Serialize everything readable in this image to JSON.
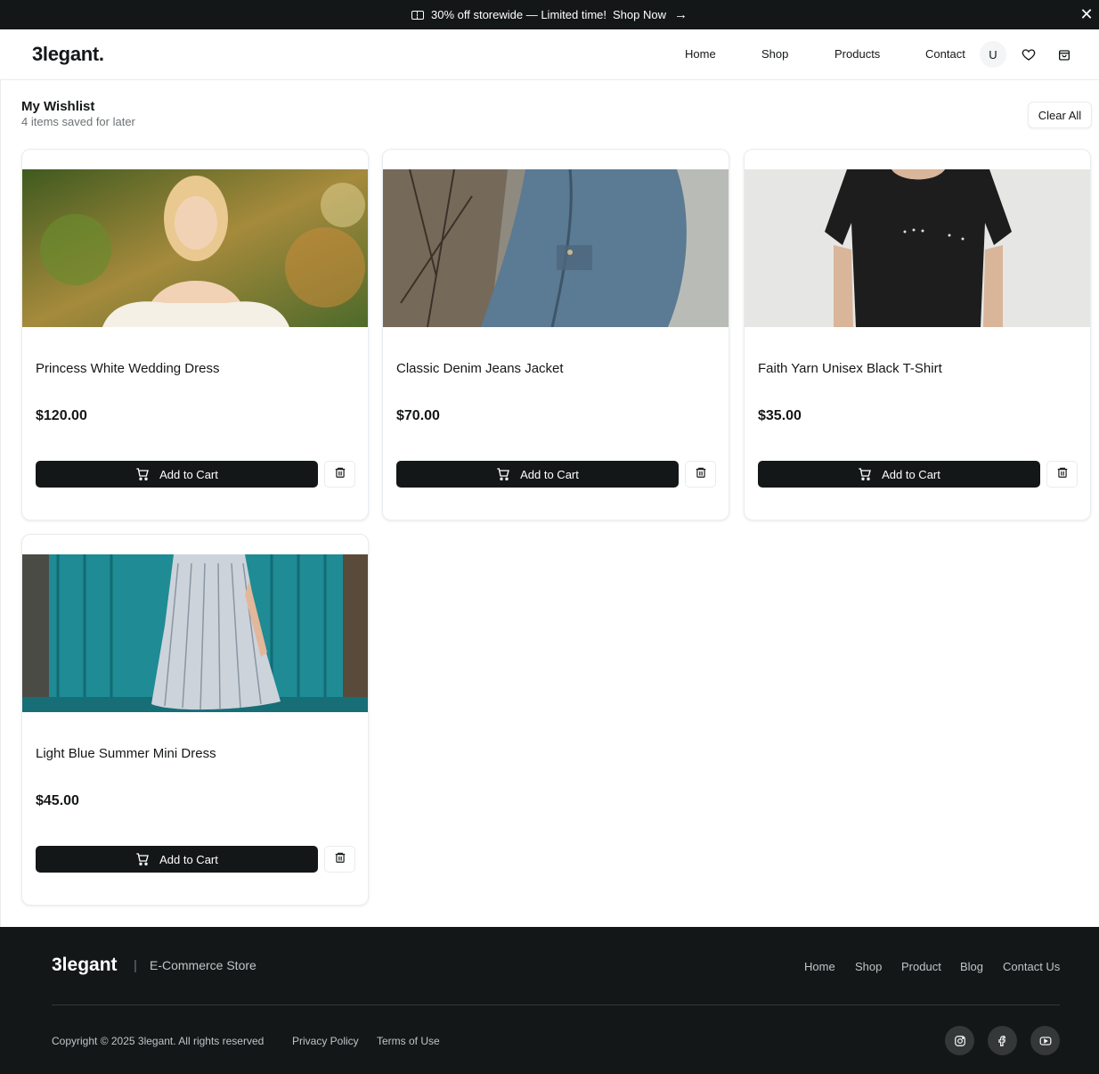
{
  "promo": {
    "text": "30% off storewide — Limited time!",
    "link": "Shop Now",
    "arrow": "→",
    "close": "✕"
  },
  "header": {
    "logo": "3legant.",
    "nav": [
      "Home",
      "Shop",
      "Products",
      "Contact"
    ],
    "avatar": "U"
  },
  "wishlist": {
    "title": "My Wishlist",
    "subtitle": "4 items saved for later",
    "clear_label": "Clear All",
    "add_label": "Add to Cart",
    "items": [
      {
        "name": "Princess White Wedding Dress",
        "price": "$120.00"
      },
      {
        "name": "Classic Denim Jeans Jacket",
        "price": "$70.00"
      },
      {
        "name": "Faith Yarn Unisex Black T-Shirt",
        "price": "$35.00"
      },
      {
        "name": "Light Blue Summer Mini Dress",
        "price": "$45.00"
      }
    ]
  },
  "footer": {
    "logo": "3legant",
    "separator": "|",
    "tagline": "E-Commerce Store",
    "links": [
      "Home",
      "Shop",
      "Product",
      "Blog",
      "Contact Us"
    ],
    "copyright": "Copyright © 2025 3legant. All rights reserved",
    "privacy": "Privacy Policy",
    "terms": "Terms of Use",
    "social": [
      "instagram-icon",
      "facebook-icon",
      "youtube-icon"
    ]
  }
}
